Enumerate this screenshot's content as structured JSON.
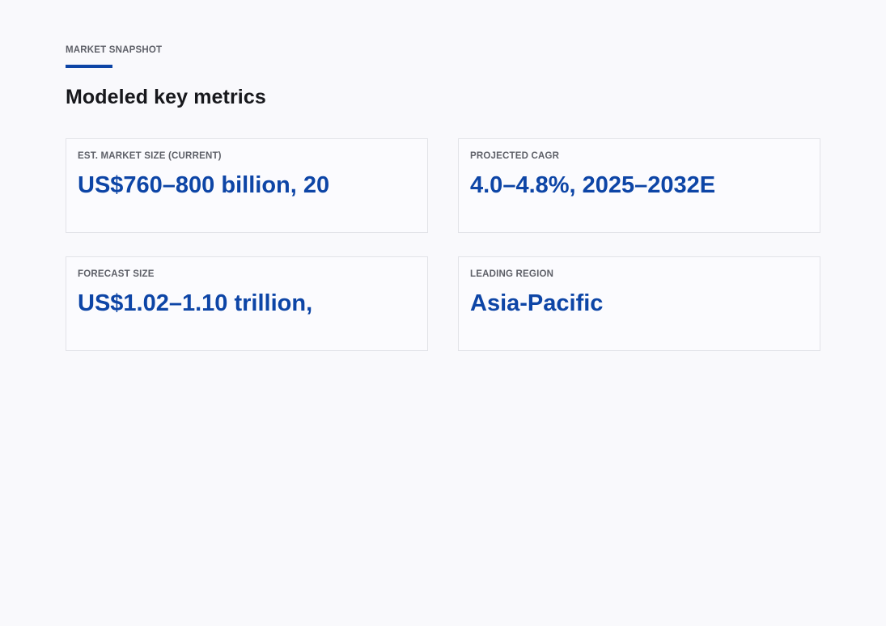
{
  "section": {
    "eyebrow": "MARKET SNAPSHOT",
    "heading": "Modeled key metrics",
    "accent_color": "#0d45a6"
  },
  "metrics": [
    {
      "label": "EST. MARKET SIZE (CURRENT)",
      "value": "US$760–800 billion, 20"
    },
    {
      "label": "PROJECTED CAGR",
      "value": "4.0–4.8%, 2025–2032E"
    },
    {
      "label": "FORECAST SIZE",
      "value": "US$1.02–1.10 trillion,"
    },
    {
      "label": "LEADING REGION",
      "value": "Asia-Pacific"
    }
  ]
}
